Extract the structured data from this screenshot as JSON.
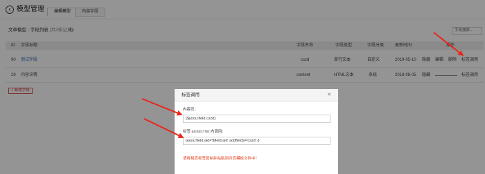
{
  "header": {
    "back_icon": "back-arrow-icon",
    "title": "模型管理",
    "tabs": [
      {
        "label": "编辑模型",
        "active": true
      },
      {
        "label": "内容字段",
        "active": false
      }
    ]
  },
  "toolbar": {
    "breadcrumb": "文章模型 - 字段列表",
    "count": "(共2条记录)",
    "refresh_icon": "refresh-icon",
    "search_placeholder": "字段搜索..."
  },
  "table": {
    "columns": [
      "ID",
      "字段标题",
      "字段名称",
      "字段类型",
      "字段分类",
      "更新时间",
      "操作"
    ],
    "rows": [
      {
        "id": "90",
        "title": "测试字段",
        "name": "cszd",
        "type": "单行文本",
        "category": "自定义",
        "updated": "2019-05-10",
        "actions": [
          "隐藏",
          "编辑",
          "删除",
          "标签调用"
        ]
      },
      {
        "id": "29",
        "title": "内容详情",
        "name": "content",
        "type": "HTML文本",
        "category": "系统",
        "updated": "2018-08-05",
        "actions": [
          "隐藏",
          "标签调用"
        ]
      }
    ],
    "add_button": "+ 新增字段"
  },
  "modal": {
    "title": "标签调用",
    "close_icon": "close-icon",
    "content_page_label": "内容页：",
    "content_page_value": "{$yoou:field.cszd}",
    "list_label": "标签 arclist / list 内调用：",
    "list_value": "{eyou:field.aid='$field.aid' addfields='cszd' /}",
    "warning": "请将相应标签复制并粘贴到对应模板文件中！"
  },
  "colors": {
    "overlay": "rgba(0,0,0,0.42)",
    "link": "#2e6db4",
    "warning": "#e0421d",
    "arrow": "#e8261c"
  }
}
